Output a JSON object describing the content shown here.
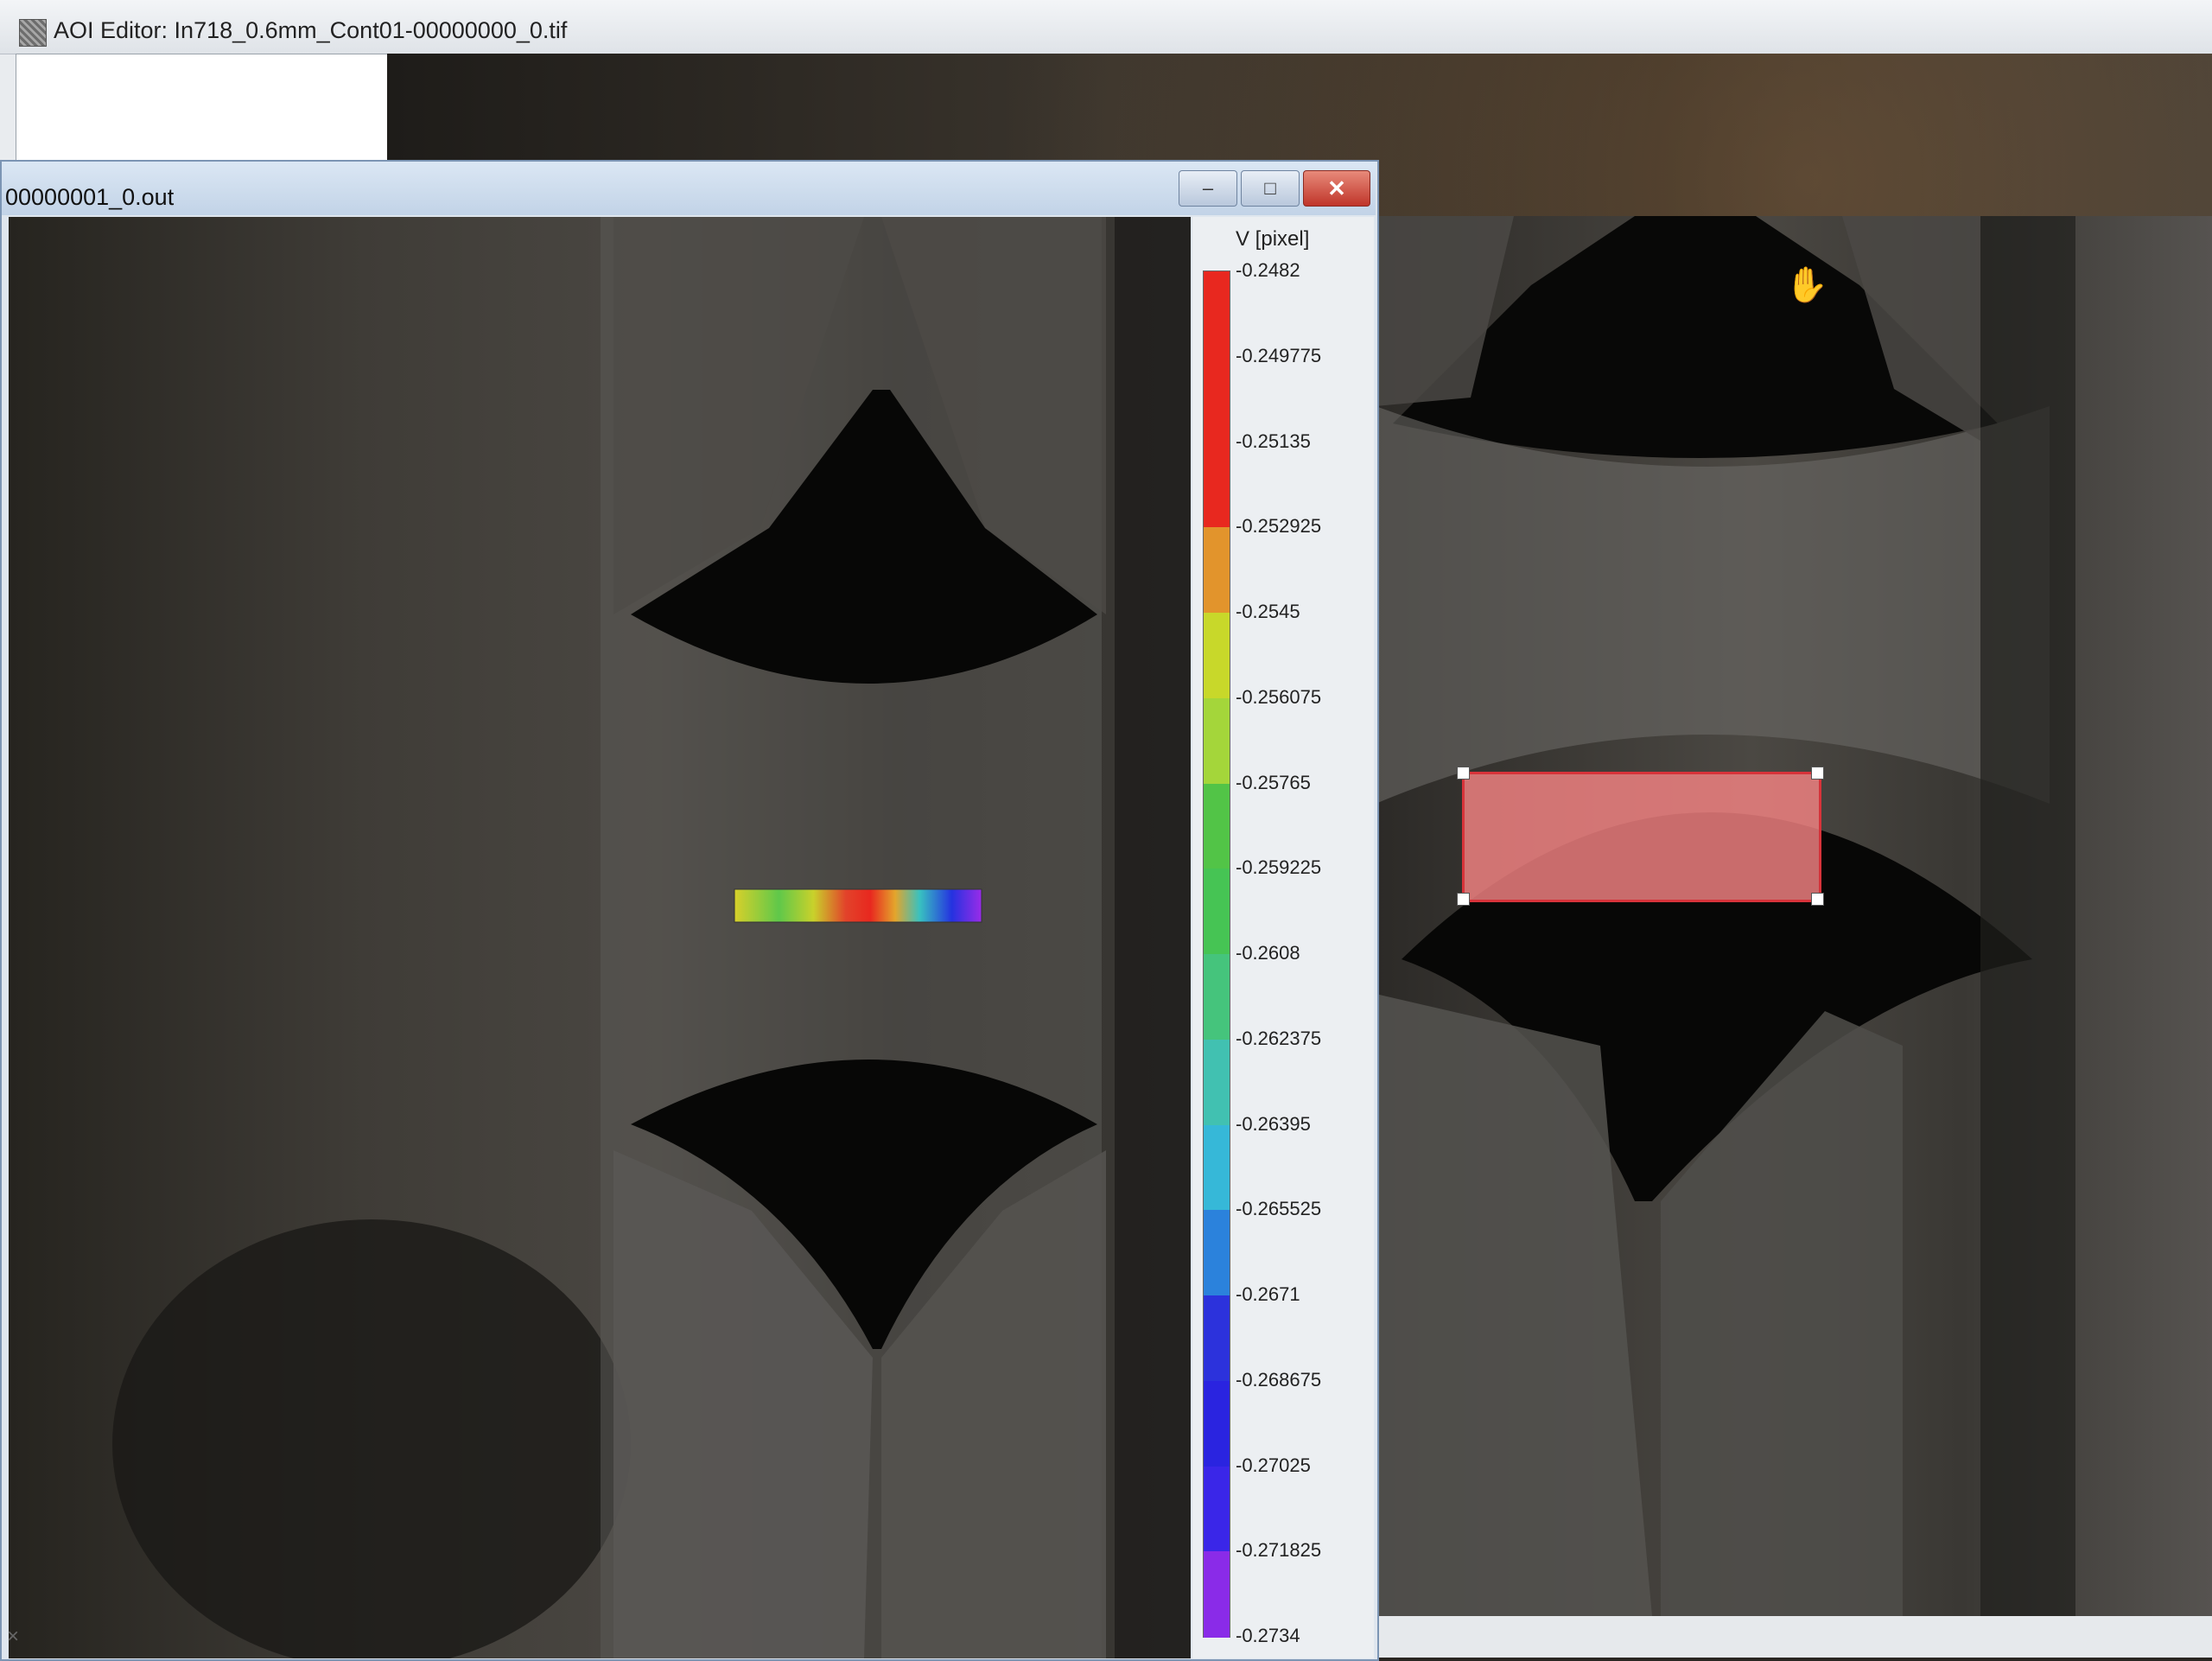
{
  "aoi_editor": {
    "title": "AOI Editor: In718_0.6mm_Cont01-00000000_0.tif"
  },
  "results_window": {
    "title": "00000001_0.out",
    "buttons": {
      "minimize": "–",
      "maximize": "□",
      "close": "✕"
    }
  },
  "colorbar": {
    "title": "V [pixel]",
    "ticks": [
      "-0.2482",
      "-0.249775",
      "-0.25135",
      "-0.252925",
      "-0.2545",
      "-0.256075",
      "-0.25765",
      "-0.259225",
      "-0.2608",
      "-0.262375",
      "-0.26395",
      "-0.265525",
      "-0.2671",
      "-0.268675",
      "-0.27025",
      "-0.271825",
      "-0.2734"
    ],
    "colors": [
      "#e8281f",
      "#e8281f",
      "#e8281f",
      "#e2942c",
      "#c8d82a",
      "#a4d63a",
      "#52c447",
      "#46c454",
      "#45c47c",
      "#41c1b1",
      "#36b8d8",
      "#2b82dc",
      "#2c32dc",
      "#2a24e0",
      "#3a26e8",
      "#8a2be8",
      "#d02cee"
    ]
  },
  "icons": {
    "app": "aoi-editor-app-icon",
    "cursor": "hand-cursor-icon"
  },
  "cursor_glyph": "✋",
  "corner_glyph": "×"
}
